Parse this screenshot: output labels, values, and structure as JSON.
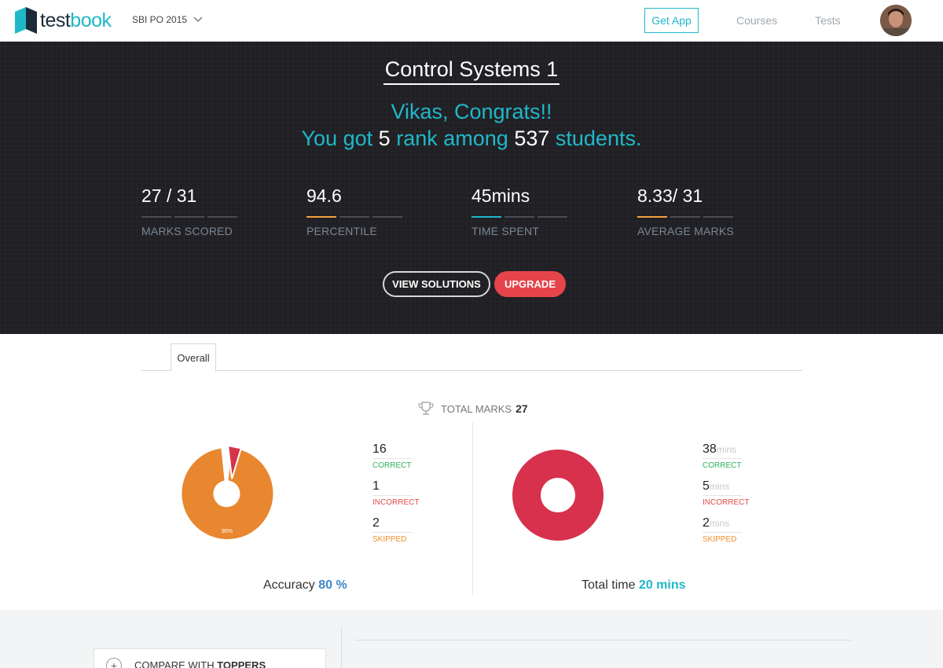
{
  "header": {
    "logo": {
      "part1": "test",
      "part2": "book"
    },
    "exam_selector": "SBI PO 2015",
    "get_app": "Get App",
    "nav": [
      "Courses",
      "Tests"
    ],
    "brand_color": "#1fb8c9"
  },
  "hero": {
    "test_title": "Control Systems 1",
    "greeting": "Vikas, Congrats!!",
    "rank_line": {
      "prefix": "You got",
      "rank": "5",
      "middle": "rank among",
      "total": "537",
      "suffix": "students."
    },
    "stats": [
      {
        "value": "27 / 31",
        "label": "MARKS SCORED",
        "accent": "#4a4d55"
      },
      {
        "value": "94.6",
        "label": "PERCENTILE",
        "accent": "#f0a23b"
      },
      {
        "value": "45mins",
        "label": "TIME SPENT",
        "accent": "#1fb8c9"
      },
      {
        "value": "8.33/ 31",
        "label": "AVERAGE MARKS",
        "accent": "#f0a23b"
      }
    ],
    "buttons": {
      "view_solutions": "VIEW SOLUTIONS",
      "upgrade": "UPGRADE"
    }
  },
  "analysis": {
    "tab": "Overall",
    "total_marks_label": "TOTAL MARKS",
    "total_marks_value": "27",
    "accuracy": {
      "legend": [
        {
          "value": "16",
          "label": "CORRECT",
          "color": "#2fb25a"
        },
        {
          "value": "1",
          "label": "INCORRECT",
          "color": "#e24a4a"
        },
        {
          "value": "2",
          "label": "SKIPPED",
          "color": "#ef8f2d"
        }
      ],
      "slice_label": "95%",
      "caption_prefix": "Accuracy",
      "caption_value": "80 %"
    },
    "time": {
      "legend": [
        {
          "value": "38",
          "unit": "mins",
          "label": "CORRECT",
          "color": "#2fb25a"
        },
        {
          "value": "5",
          "unit": "mins",
          "label": "INCORRECT",
          "color": "#e24a4a"
        },
        {
          "value": "2",
          "unit": "mins",
          "label": "SKIPPED",
          "color": "#ef8f2d"
        }
      ],
      "caption_prefix": "Total time",
      "caption_value": "20 mins"
    }
  },
  "bottom": {
    "compare_prefix": "COMPARE WITH",
    "compare_bold": "TOPPERS"
  }
}
